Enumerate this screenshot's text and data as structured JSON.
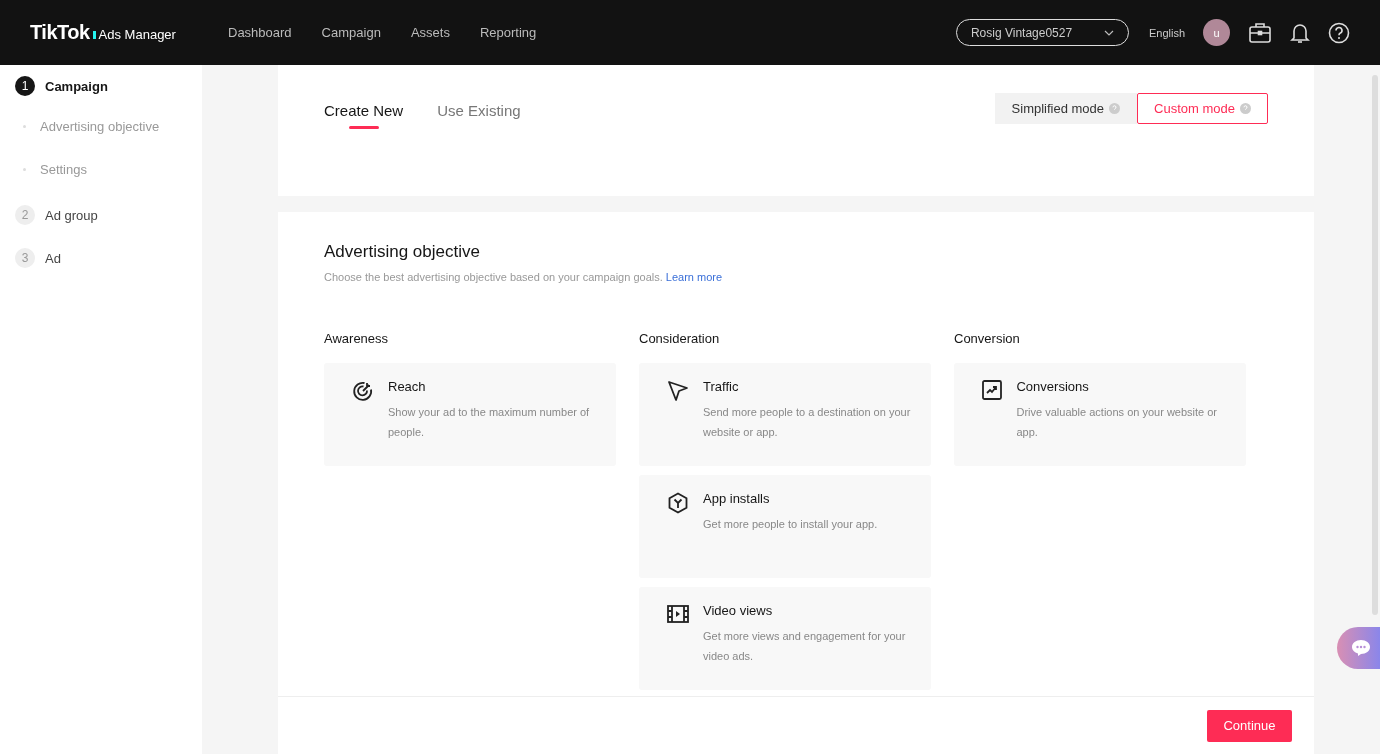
{
  "header": {
    "logo": "TikTok",
    "logo_suffix": "Ads Manager",
    "nav": [
      {
        "label": "Dashboard",
        "selected": false
      },
      {
        "label": "Campaign",
        "selected": false
      },
      {
        "label": "Assets",
        "selected": false
      },
      {
        "label": "Reporting",
        "selected": false
      }
    ],
    "account": "Rosig Vintage0527",
    "language": "English",
    "avatar": "u"
  },
  "sidebar": {
    "steps": [
      {
        "number": "1",
        "label": "Campaign",
        "selected": true,
        "children": [
          {
            "label": "Advertising objective"
          },
          {
            "label": "Settings"
          }
        ]
      },
      {
        "number": "2",
        "label": "Ad group",
        "selected": false
      },
      {
        "number": "3",
        "label": "Ad",
        "selected": false
      }
    ]
  },
  "tabs": [
    {
      "label": "Create New",
      "selected": true
    },
    {
      "label": "Use Existing",
      "selected": false
    }
  ],
  "modes": [
    {
      "label": "Simplified mode",
      "selected": false
    },
    {
      "label": "Custom mode",
      "selected": true
    }
  ],
  "objective": {
    "title": "Advertising objective",
    "subtitle": "Choose the best advertising objective based on your campaign goals.",
    "link": "Learn more",
    "groups": [
      {
        "title": "Awareness",
        "options": [
          {
            "kind": "reach",
            "title": "Reach",
            "description": "Show your ad to the maximum number of people."
          }
        ]
      },
      {
        "title": "Consideration",
        "options": [
          {
            "kind": "traffic",
            "title": "Traffic",
            "description": "Send more people to a destination on your website or app."
          },
          {
            "kind": "app",
            "title": "App installs",
            "description": "Get more people to install your app."
          },
          {
            "kind": "video",
            "title": "Video views",
            "description": "Get more views and engagement for your video ads."
          }
        ]
      },
      {
        "title": "Conversion",
        "options": [
          {
            "kind": "conversion",
            "title": "Conversions",
            "description": "Drive valuable actions on your website or app."
          }
        ]
      }
    ]
  },
  "footer": {
    "button": "Continue"
  }
}
